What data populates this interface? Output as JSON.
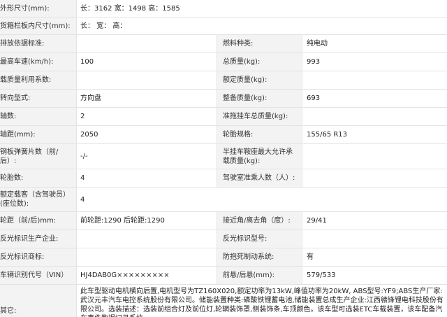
{
  "rows": [
    {
      "type": "wide",
      "label": "外形尺寸(mm):",
      "value": "长：3162 宽：1498 高：1585"
    },
    {
      "type": "wide",
      "label": "货箱栏板内尺寸(mm):",
      "value": "长：  宽：  高："
    },
    {
      "type": "pair",
      "l1": "排放依据标准:",
      "v1": "",
      "l2": "燃料种类:",
      "v2": "纯电动"
    },
    {
      "type": "pair",
      "l1": "最高车速(km/h):",
      "v1": "100",
      "l2": "总质量(kg):",
      "v2": "993"
    },
    {
      "type": "pair",
      "l1": "载质量利用系数:",
      "v1": "",
      "l2": "额定质量(kg):",
      "v2": ""
    },
    {
      "type": "pair",
      "l1": "转向型式:",
      "v1": "方向盘",
      "l2": "整备质量(kg):",
      "v2": "693"
    },
    {
      "type": "pair",
      "l1": "轴数:",
      "v1": "2",
      "l2": "准拖挂车总质量(kg):",
      "v2": ""
    },
    {
      "type": "pair",
      "l1": "轴距(mm):",
      "v1": "2050",
      "l2": "轮胎规格:",
      "v2": "155/65 R13"
    },
    {
      "type": "pair",
      "l1": "钢板弹簧片数（前/后）:",
      "v1": "-/-",
      "l2": "半挂车鞍座最大允许承载质量(kg):",
      "v2": ""
    },
    {
      "type": "pair",
      "l1": "轮胎数:",
      "v1": "4",
      "l2": "驾驶室准乘人数（人）:",
      "v2": ""
    },
    {
      "type": "wide",
      "label": "额定载客（含驾驶员）(座位数):",
      "value": "4"
    },
    {
      "type": "pair",
      "l1": "轮距（前/后)mm:",
      "v1": "前轮距:1290 后轮距:1290",
      "l2": "接近角/离去角（度）:",
      "v2": "29/41"
    },
    {
      "type": "pair",
      "l1": "反光标识生产企业:",
      "v1": "",
      "l2": "反光标识型号:",
      "v2": ""
    },
    {
      "type": "pair",
      "l1": "反光标识商标:",
      "v1": "",
      "l2": "防抱死制动系统:",
      "v2": "有"
    },
    {
      "type": "pair",
      "l1": "车辆识别代号（VIN）",
      "v1": "HJ4DAB0G×××××××××",
      "l2": "前悬/后悬(mm):",
      "v2": "579/533"
    },
    {
      "type": "note",
      "label": "其它:",
      "value": "此车型驱动电机横向后置,电机型号为TZ160X020,额定功率为13kW,峰值功率为20kW, ABS型号:YF9;ABS生产厂家:武汉元丰汽车电控系统股份有限公司。储能装置种类:磷酸铁锂蓄电池,储能装置总成生产企业:江西赣锋锂电科技股份有限公司。选装描述：选装前组合灯及前位灯,轮辋装饰罩,侧装饰条,车顶颜色。该车型可选装ETC车载装置，该车配备汽车事件数据记录系统"
    }
  ]
}
